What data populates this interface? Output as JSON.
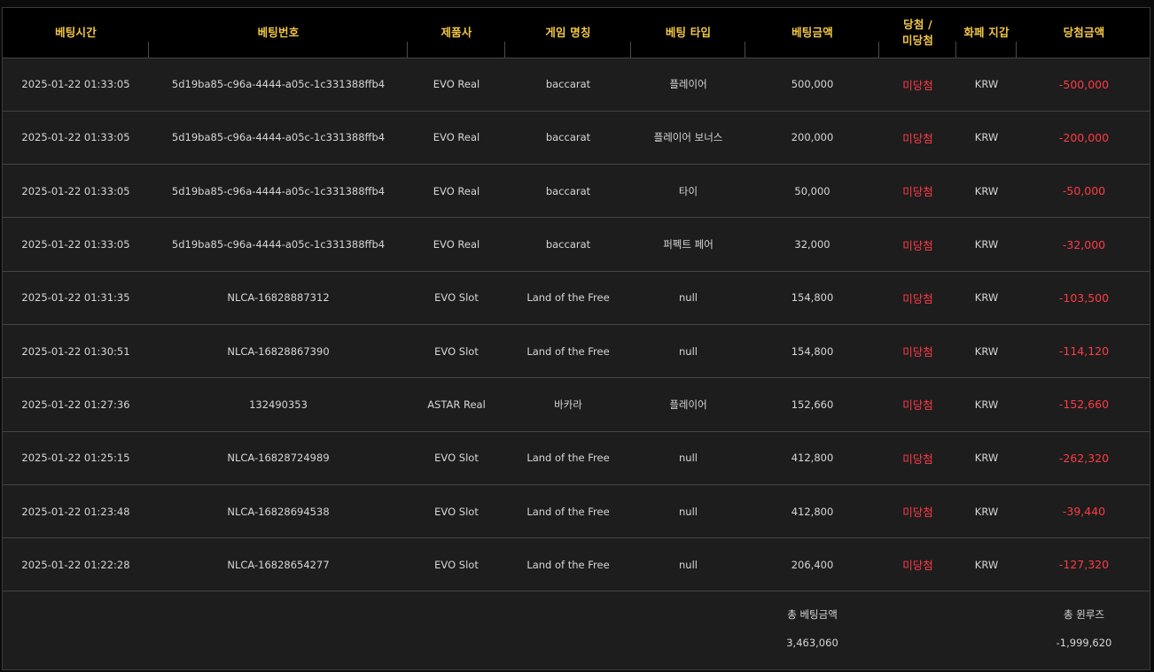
{
  "columns": [
    "베팅시간",
    "베팅번호",
    "제품사",
    "게임 명칭",
    "베팅 타입",
    "베팅금액",
    "당첨 /\n미당첨",
    "화페 지갑",
    "당첨금액"
  ],
  "rows": [
    {
      "time": "2025-01-22 01:33:05",
      "bet_no": "5d19ba85-c96a-4444-a05c-1c331388ffb4",
      "vendor": "EVO Real",
      "game": "baccarat",
      "bet_type": "플레이어",
      "amount": "500,000",
      "result": "미당첨",
      "wallet": "KRW",
      "win_amount": "-500,000"
    },
    {
      "time": "2025-01-22 01:33:05",
      "bet_no": "5d19ba85-c96a-4444-a05c-1c331388ffb4",
      "vendor": "EVO Real",
      "game": "baccarat",
      "bet_type": "플레이어 보너스",
      "amount": "200,000",
      "result": "미당첨",
      "wallet": "KRW",
      "win_amount": "-200,000"
    },
    {
      "time": "2025-01-22 01:33:05",
      "bet_no": "5d19ba85-c96a-4444-a05c-1c331388ffb4",
      "vendor": "EVO Real",
      "game": "baccarat",
      "bet_type": "타이",
      "amount": "50,000",
      "result": "미당첨",
      "wallet": "KRW",
      "win_amount": "-50,000"
    },
    {
      "time": "2025-01-22 01:33:05",
      "bet_no": "5d19ba85-c96a-4444-a05c-1c331388ffb4",
      "vendor": "EVO Real",
      "game": "baccarat",
      "bet_type": "퍼펙트 페어",
      "amount": "32,000",
      "result": "미당첨",
      "wallet": "KRW",
      "win_amount": "-32,000"
    },
    {
      "time": "2025-01-22 01:31:35",
      "bet_no": "NLCA-16828887312",
      "vendor": "EVO Slot",
      "game": "Land of the Free",
      "bet_type": "null",
      "amount": "154,800",
      "result": "미당첨",
      "wallet": "KRW",
      "win_amount": "-103,500"
    },
    {
      "time": "2025-01-22 01:30:51",
      "bet_no": "NLCA-16828867390",
      "vendor": "EVO Slot",
      "game": "Land of the Free",
      "bet_type": "null",
      "amount": "154,800",
      "result": "미당첨",
      "wallet": "KRW",
      "win_amount": "-114,120"
    },
    {
      "time": "2025-01-22 01:27:36",
      "bet_no": "132490353",
      "vendor": "ASTAR Real",
      "game": "바카라",
      "bet_type": "플레이어",
      "amount": "152,660",
      "result": "미당첨",
      "wallet": "KRW",
      "win_amount": "-152,660"
    },
    {
      "time": "2025-01-22 01:25:15",
      "bet_no": "NLCA-16828724989",
      "vendor": "EVO Slot",
      "game": "Land of the Free",
      "bet_type": "null",
      "amount": "412,800",
      "result": "미당첨",
      "wallet": "KRW",
      "win_amount": "-262,320"
    },
    {
      "time": "2025-01-22 01:23:48",
      "bet_no": "NLCA-16828694538",
      "vendor": "EVO Slot",
      "game": "Land of the Free",
      "bet_type": "null",
      "amount": "412,800",
      "result": "미당첨",
      "wallet": "KRW",
      "win_amount": "-39,440"
    },
    {
      "time": "2025-01-22 01:22:28",
      "bet_no": "NLCA-16828654277",
      "vendor": "EVO Slot",
      "game": "Land of the Free",
      "bet_type": "null",
      "amount": "206,400",
      "result": "미당첨",
      "wallet": "KRW",
      "win_amount": "-127,320"
    }
  ],
  "summary": {
    "total_bet_label": "총 베팅금액",
    "total_bet_value": "3,463,060",
    "total_winloss_label": "총 윈루즈",
    "total_winloss_value": "-1,999,620"
  },
  "colors": {
    "header_bg": "#000000",
    "header_text": "#f3c744",
    "body_bg": "#1d1d1d",
    "loss_red": "#ff3a46",
    "row_border": "#454545"
  }
}
